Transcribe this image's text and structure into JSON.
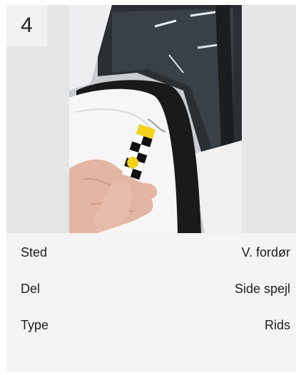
{
  "damage_card": {
    "number": "4",
    "photo_alt": "photo-of-side-mirror-scratch",
    "details": [
      {
        "label": "Sted",
        "value": "V. fordør"
      },
      {
        "label": "Del",
        "value": "Side spejl"
      },
      {
        "label": "Type",
        "value": "Rids"
      }
    ]
  },
  "colors": {
    "card_bg": "#f4f4f4",
    "photo_bg": "#e6e6e6",
    "text": "#1d1d1d",
    "marker_yellow": "#f2d21a"
  }
}
